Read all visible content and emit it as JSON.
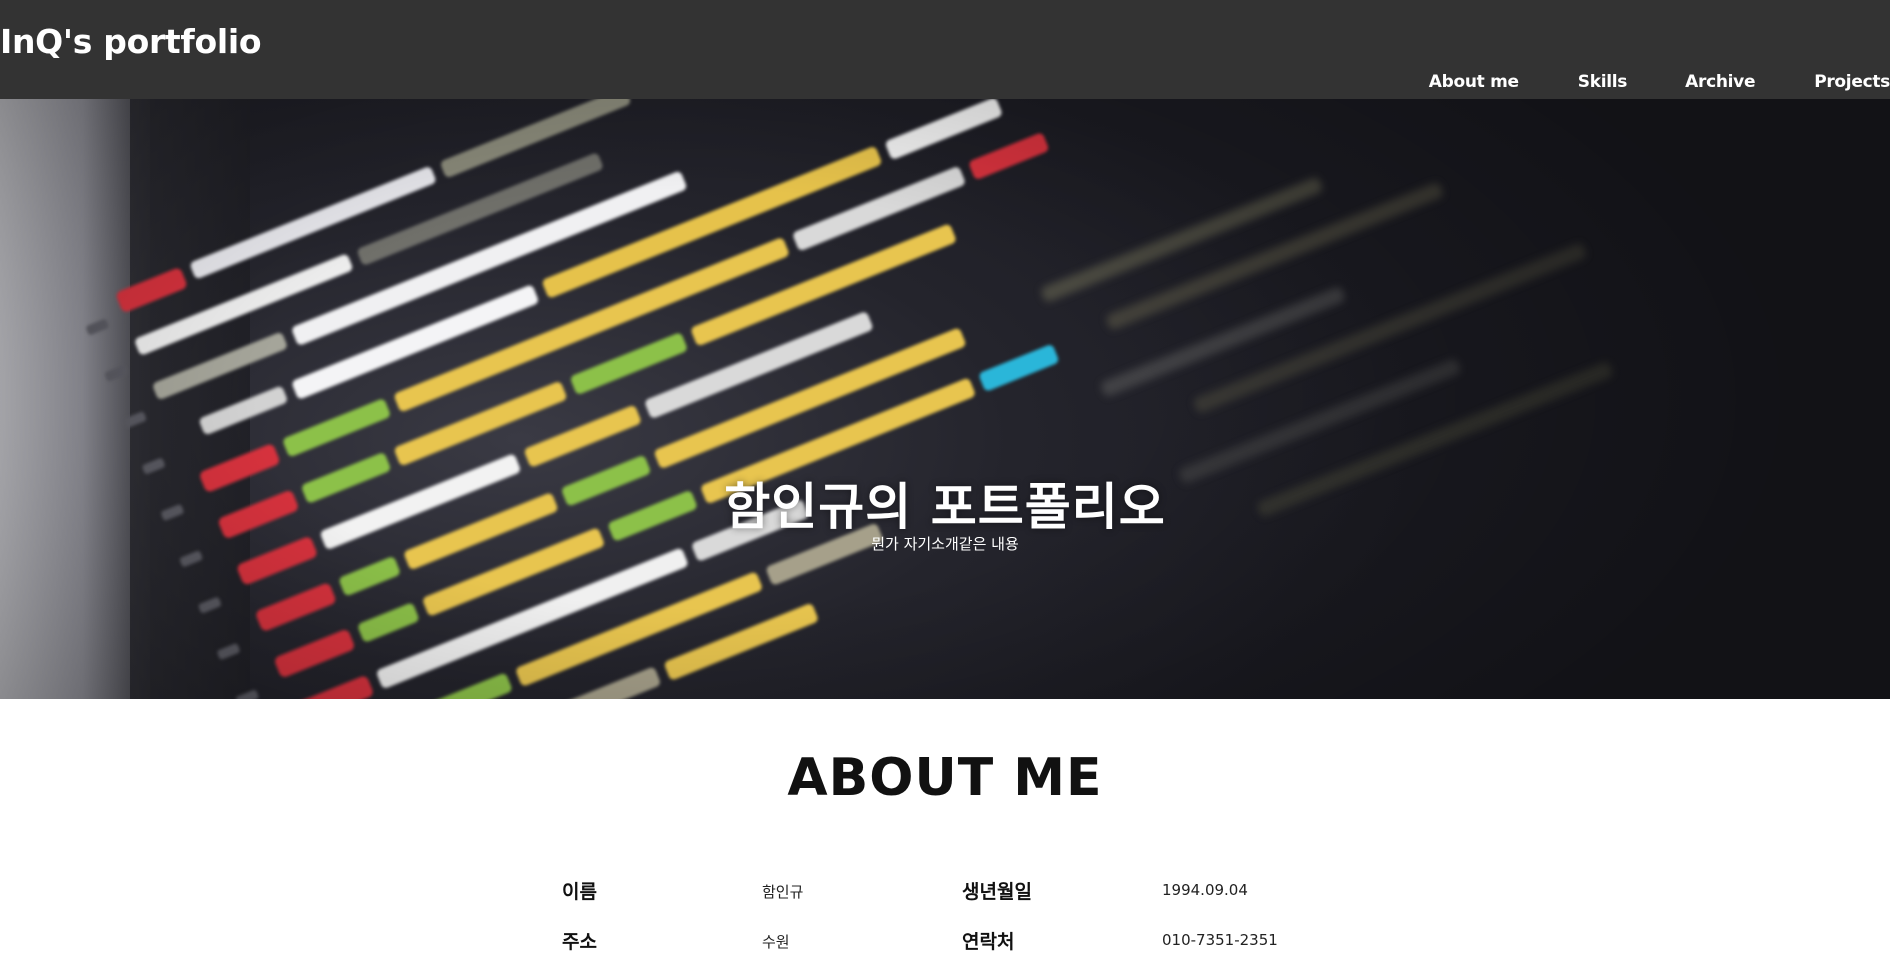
{
  "header": {
    "brand": "InQ's portfolio",
    "nav": [
      "About me",
      "Skills",
      "Archive",
      "Projects"
    ]
  },
  "hero": {
    "title": "함인규의 포트폴리오",
    "subtitle": "뭔가 자기소개같은 내용",
    "background": "code-screen-image"
  },
  "about": {
    "heading": "ABOUT ME",
    "fields": [
      {
        "label": "이름",
        "value": "함인규"
      },
      {
        "label": "생년월일",
        "value": "1994.09.04"
      },
      {
        "label": "주소",
        "value": "수원"
      },
      {
        "label": "연락처",
        "value": "010-7351-2351"
      }
    ]
  },
  "colors": {
    "header_bg": "#333333",
    "hero_bg": "#1e1e26",
    "page_bg": "#ffffff"
  }
}
